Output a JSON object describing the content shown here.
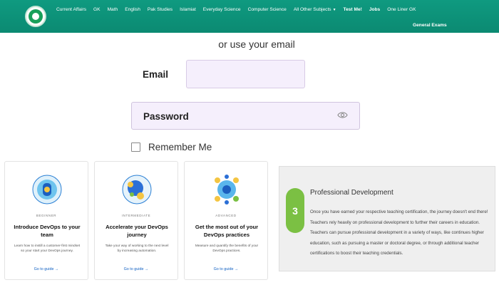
{
  "nav": {
    "items": [
      "Current Affairs",
      "GK",
      "Math",
      "English",
      "Pak Studies",
      "Islamiat",
      "Everyday Science",
      "Computer Science",
      "All Other Subjects",
      "Test Me!",
      "Jobs",
      "One Liner GK"
    ],
    "second_row": "General Exams",
    "color": "#0f9a80"
  },
  "form": {
    "or_text": "or use your email",
    "email_label": "Email",
    "email_value": "",
    "password_label": "Password",
    "remember_label": "Remember Me",
    "remember_checked": false
  },
  "cards": [
    {
      "level": "BEGINNER",
      "title": "Introduce DevOps to your team",
      "desc": "Learn how to instill a customer-first mindset so your start your DevOps journey.",
      "link": "Go to guide →"
    },
    {
      "level": "INTERMEDIATE",
      "title": "Accelerate your DevOps journey",
      "desc": "Take your way of working to the next level by increasing automation.",
      "link": "Go to guide →"
    },
    {
      "level": "ADVANCED",
      "title": "Get the most out of your DevOps practices",
      "desc": "Measure and quantify the benefits of your DevOps practices.",
      "link": "Go to guide →"
    }
  ],
  "panel": {
    "number": "3",
    "title": "Professional Development",
    "body": "Once you have earned your respective teaching certification, the journey doesn't end there! Teachers rely heavily on professional development to further their careers in education. Teachers can pursue professional development in a variety of ways, like continues higher education, such as pursuing a master or doctoral degree, or through additional teacher certifications to boost their teaching credentials.",
    "badge_color": "#7bc043"
  }
}
